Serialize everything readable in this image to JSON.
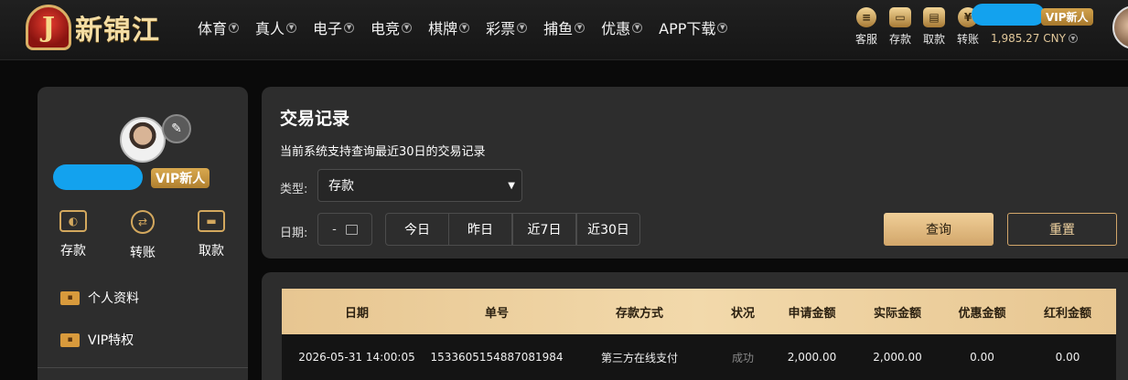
{
  "brand": {
    "logo_letter": "J",
    "name": "新锦江"
  },
  "nav": [
    "体育",
    "真人",
    "电子",
    "电竞",
    "棋牌",
    "彩票",
    "捕鱼",
    "优惠",
    "APP下载"
  ],
  "header_actions": [
    {
      "label": "客服",
      "icon": "support-icon"
    },
    {
      "label": "存款",
      "icon": "wallet-icon"
    },
    {
      "label": "取款",
      "icon": "withdraw-icon"
    },
    {
      "label": "转账",
      "icon": "transfer-icon"
    }
  ],
  "account": {
    "vip_level": "VIP新人",
    "balance": "1,985.27 CNY"
  },
  "side": {
    "vip_level": "VIP新人",
    "actions": [
      {
        "label": "存款",
        "icon": "wallet-icon"
      },
      {
        "label": "转账",
        "icon": "transfer-icon"
      },
      {
        "label": "取款",
        "icon": "card-icon"
      }
    ],
    "menu": [
      {
        "label": "个人资料",
        "icon": "profile-card-icon"
      },
      {
        "label": "VIP特权",
        "icon": "vip-card-icon"
      }
    ]
  },
  "panel": {
    "title": "交易记录",
    "subtitle": "当前系统支持查询最近30日的交易记录",
    "type_label": "类型:",
    "type_value": "存款",
    "date_label": "日期:",
    "date_value": "-",
    "quick_ranges": [
      "今日",
      "昨日",
      "近7日",
      "近30日"
    ],
    "query_label": "查询",
    "reset_label": "重置"
  },
  "table": {
    "headers": [
      "日期",
      "单号",
      "存款方式",
      "状况",
      "申请金额",
      "实际金额",
      "优惠金额",
      "红利金额"
    ],
    "rows": [
      [
        "2026-05-31 14:00:05",
        "1533605154887081984",
        "第三方在线支付",
        "成功",
        "2,000.00",
        "2,000.00",
        "0.00",
        "0.00"
      ]
    ]
  },
  "colors": {
    "accent": "#d9b06b",
    "panel": "#2d2d2d",
    "mask": "#13a2ee"
  }
}
